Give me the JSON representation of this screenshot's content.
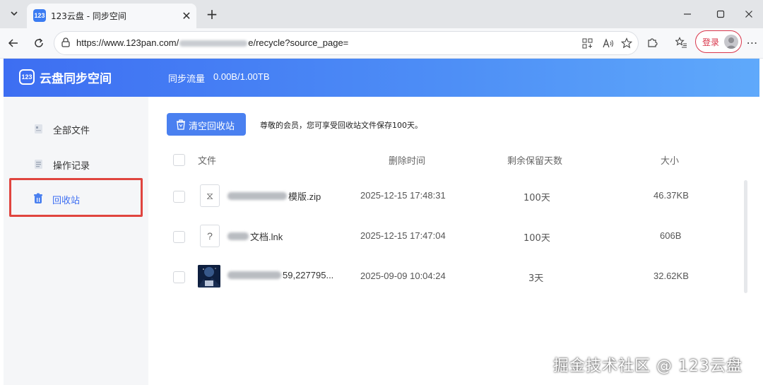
{
  "browser": {
    "tab": {
      "favicon_text": "123",
      "title": "123云盘 - 同步空间"
    },
    "new_tab_symbol": "+",
    "url": {
      "prefix": "https://www.123pan.com/",
      "suffix": "e/recycle?source_page="
    },
    "login_label": "登录"
  },
  "header": {
    "logo_box": "123",
    "logo_text": "云盘同步空间",
    "traffic_label": "同步流量",
    "traffic_value": "0.00B/1.00TB"
  },
  "sidebar": {
    "items": [
      {
        "label": "全部文件",
        "icon": "folder-icon"
      },
      {
        "label": "操作记录",
        "icon": "record-icon"
      },
      {
        "label": "回收站",
        "icon": "trash-icon",
        "active": true
      }
    ]
  },
  "main": {
    "empty_button": "清空回收站",
    "notice": "尊敬的会员，您可享受回收站文件保存100天。",
    "columns": [
      "文件",
      "删除时间",
      "剩余保留天数",
      "大小"
    ],
    "rows": [
      {
        "name": "模版.zip",
        "icon": "zip-file-icon",
        "thumb": "⧖",
        "deleted": "2025-12-15 17:48:31",
        "days": "100天",
        "size": "46.37KB"
      },
      {
        "name": "文档.lnk",
        "icon": "unknown-file-icon",
        "thumb": "?",
        "deleted": "2025-12-15 17:47:04",
        "days": "100天",
        "size": "606B"
      },
      {
        "name": "59,227795...",
        "icon": "image-thumbnail-icon",
        "thumb": "",
        "deleted": "2025-09-09 10:04:24",
        "days": "3天",
        "size": "32.62KB"
      }
    ]
  },
  "watermark": "掘金技术社区 @ 123云盘",
  "colors": {
    "accent": "#3d6ef2",
    "highlight_border": "#e0453f",
    "login_red": "#d9364b"
  }
}
